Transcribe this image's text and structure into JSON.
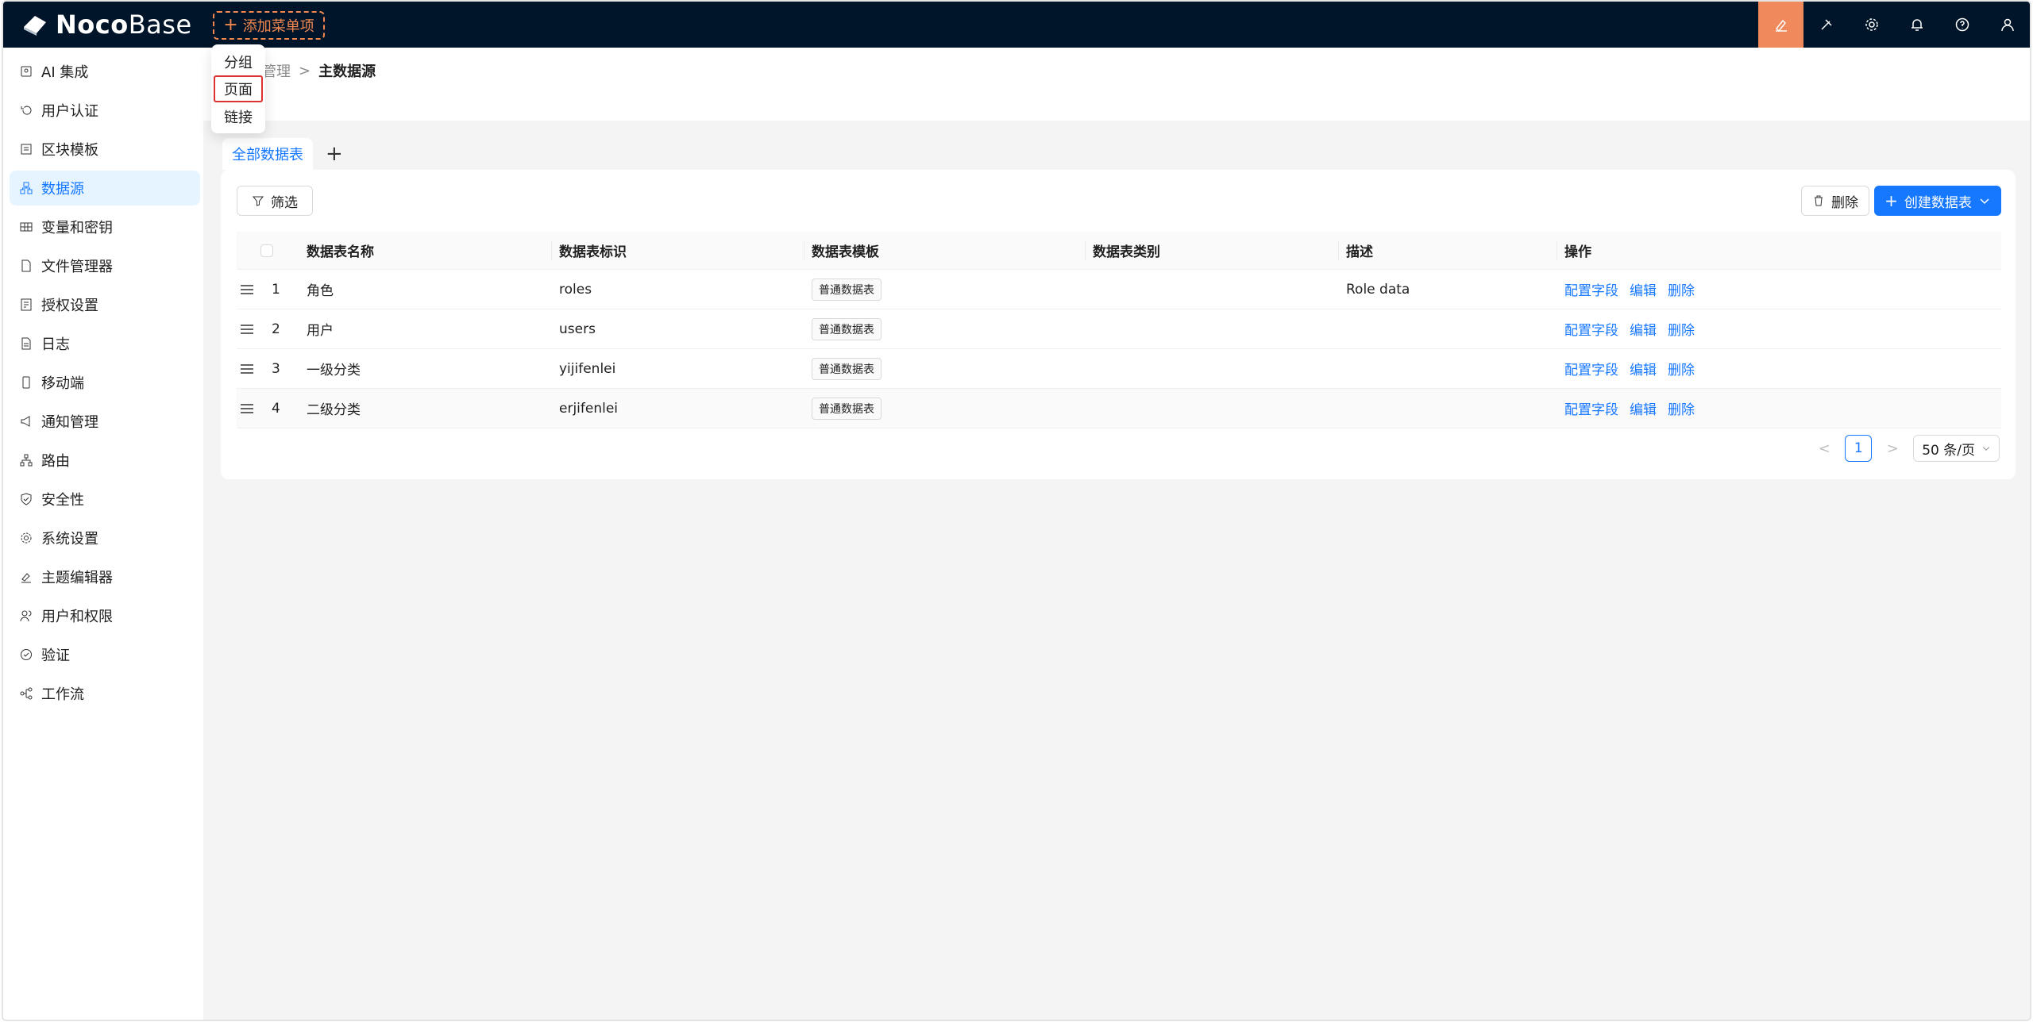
{
  "topbar": {
    "logo_bold": "Noco",
    "logo_light": "Base",
    "add_menu_label": "添加菜单项",
    "icons": [
      "theme-editor-icon",
      "plugin-icon",
      "settings-icon",
      "bell-icon",
      "help-icon",
      "user-icon"
    ],
    "active_color": "#f08a5d"
  },
  "add_menu_dropdown": {
    "items": [
      "分组",
      "页面",
      "链接"
    ],
    "highlighted": "页面"
  },
  "sidebar": {
    "items": [
      {
        "label": "AI 集成",
        "icon": "ai-icon"
      },
      {
        "label": "用户认证",
        "icon": "login-icon"
      },
      {
        "label": "区块模板",
        "icon": "block-template-icon"
      },
      {
        "label": "数据源",
        "icon": "database-icon",
        "selected": true
      },
      {
        "label": "变量和密钥",
        "icon": "table-icon"
      },
      {
        "label": "文件管理器",
        "icon": "file-icon"
      },
      {
        "label": "授权设置",
        "icon": "license-icon"
      },
      {
        "label": "日志",
        "icon": "log-icon"
      },
      {
        "label": "移动端",
        "icon": "mobile-icon"
      },
      {
        "label": "通知管理",
        "icon": "notification-icon"
      },
      {
        "label": "路由",
        "icon": "route-icon"
      },
      {
        "label": "安全性",
        "icon": "shield-icon"
      },
      {
        "label": "系统设置",
        "icon": "gear-icon"
      },
      {
        "label": "主题编辑器",
        "icon": "brush-icon"
      },
      {
        "label": "用户和权限",
        "icon": "users-icon"
      },
      {
        "label": "验证",
        "icon": "check-circle-icon"
      },
      {
        "label": "工作流",
        "icon": "workflow-icon"
      }
    ]
  },
  "breadcrumb": {
    "parent": "管理",
    "separator": ">",
    "current": "主数据源"
  },
  "tabs": {
    "items": [
      "全部数据表"
    ],
    "add": "+"
  },
  "toolbar": {
    "filter_label": "筛选",
    "delete_label": "删除",
    "create_label": "创建数据表"
  },
  "table": {
    "columns": [
      "数据表名称",
      "数据表标识",
      "数据表模板",
      "数据表类别",
      "描述",
      "操作"
    ],
    "rows": [
      {
        "index": "1",
        "name": "角色",
        "id": "roles",
        "template": "普通数据表",
        "category": "",
        "description": "Role data"
      },
      {
        "index": "2",
        "name": "用户",
        "id": "users",
        "template": "普通数据表",
        "category": "",
        "description": ""
      },
      {
        "index": "3",
        "name": "一级分类",
        "id": "yijifenlei",
        "template": "普通数据表",
        "category": "",
        "description": ""
      },
      {
        "index": "4",
        "name": "二级分类",
        "id": "erjifenlei",
        "template": "普通数据表",
        "category": "",
        "description": ""
      }
    ],
    "actions": [
      "配置字段",
      "编辑",
      "删除"
    ]
  },
  "pagination": {
    "prev": "<",
    "current_page": "1",
    "next": ">",
    "page_size": "50 条/页"
  }
}
